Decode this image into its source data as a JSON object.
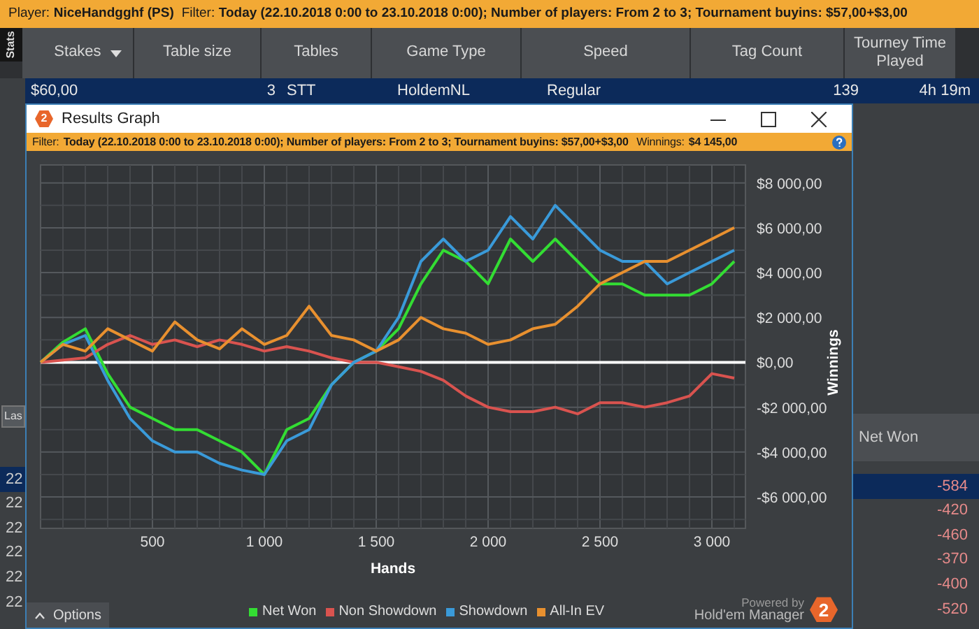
{
  "app": {
    "player_label": "Player:",
    "player": "NiceHandgghf (PS)",
    "filter_label": "Filter:",
    "filter": "Today (22.10.2018 0:00 to 23.10.2018 0:00); Number of players: From 2 to 3; Tournament buyins: $57,00+$3,00",
    "side_tab": "Stats",
    "columns": [
      "Stakes",
      "Table size",
      "Tables",
      "Game Type",
      "Speed",
      "Tag Count",
      "Tourney Time Played"
    ],
    "rows": [
      {
        "selected": true,
        "cells": [
          "$60,00",
          "3",
          "STT",
          "HoldemNL",
          "Regular",
          "139",
          "4h 19m"
        ]
      }
    ],
    "lower": {
      "button": "Las",
      "column_header": "Net Won",
      "rows": [
        {
          "date": "22",
          "net_won": "-584",
          "selected": true
        },
        {
          "date": "22",
          "net_won": "-420",
          "selected": false
        },
        {
          "date": "22",
          "net_won": "-460",
          "selected": false
        },
        {
          "date": "22",
          "net_won": "-370",
          "selected": false
        },
        {
          "date": "22",
          "net_won": "-400",
          "selected": false
        },
        {
          "date": "22",
          "net_won": "-520",
          "selected": false
        }
      ]
    }
  },
  "window": {
    "title_icon_text": "2",
    "title": "Results Graph",
    "filter_label": "Filter:",
    "filter": "Today (22.10.2018 0:00 to 23.10.2018 0:00); Number of players: From 2 to 3; Tournament buyins: $57,00+$3,00",
    "winnings_label": "Winnings:",
    "winnings": "$4 145,00",
    "chart_data": {
      "type": "line",
      "grid": true,
      "xlabel": "Hands",
      "ylabel": "Winnings",
      "x": [
        0,
        100,
        200,
        300,
        400,
        500,
        600,
        700,
        800,
        900,
        1000,
        1100,
        1200,
        1300,
        1400,
        1500,
        1600,
        1700,
        1800,
        1900,
        2000,
        2100,
        2200,
        2300,
        2400,
        2500,
        2600,
        2700,
        2800,
        2900,
        3000,
        3100
      ],
      "series": [
        {
          "name": "Net Won",
          "color": "#33dd33",
          "values": [
            0,
            900,
            1500,
            -500,
            -2000,
            -2500,
            -3000,
            -3000,
            -3500,
            -4000,
            -5000,
            -3000,
            -2500,
            -1000,
            0,
            500,
            1500,
            3500,
            5000,
            4500,
            3500,
            5500,
            4500,
            5500,
            4500,
            3500,
            3500,
            3000,
            3000,
            3000,
            3500,
            4500
          ]
        },
        {
          "name": "Non Showdown",
          "color": "#d9534f",
          "values": [
            0,
            100,
            200,
            800,
            1200,
            800,
            1000,
            700,
            1000,
            800,
            500,
            700,
            500,
            200,
            0,
            0,
            -200,
            -400,
            -800,
            -1500,
            -2000,
            -2200,
            -2200,
            -2000,
            -2300,
            -1800,
            -1800,
            -2000,
            -1800,
            -1500,
            -500,
            -700
          ]
        },
        {
          "name": "Showdown",
          "color": "#3a9ad9",
          "values": [
            0,
            800,
            1200,
            -800,
            -2500,
            -3500,
            -4000,
            -4000,
            -4500,
            -4800,
            -5000,
            -3500,
            -3000,
            -1000,
            0,
            500,
            2000,
            4500,
            5500,
            4500,
            5000,
            6500,
            5500,
            7000,
            6000,
            5000,
            4500,
            4500,
            3500,
            4000,
            4500,
            5000
          ]
        },
        {
          "name": "All-In EV",
          "color": "#e8902f",
          "values": [
            0,
            800,
            500,
            1500,
            1000,
            500,
            1800,
            1000,
            600,
            1500,
            800,
            1200,
            2500,
            1200,
            1000,
            500,
            1000,
            2000,
            1500,
            1300,
            800,
            1000,
            1500,
            1700,
            2500,
            3500,
            4000,
            4500,
            4500,
            5000,
            5500,
            6000
          ]
        }
      ],
      "xlim": [
        0,
        3150
      ],
      "ylim": [
        -7400,
        8800
      ],
      "xticks": [
        {
          "value": 500,
          "label": "500"
        },
        {
          "value": 1000,
          "label": "1 000"
        },
        {
          "value": 1500,
          "label": "1 500"
        },
        {
          "value": 2000,
          "label": "2 000"
        },
        {
          "value": 2500,
          "label": "2 500"
        },
        {
          "value": 3000,
          "label": "3 000"
        }
      ],
      "yticks": [
        {
          "value": 8000,
          "label": "$8 000,00"
        },
        {
          "value": 6000,
          "label": "$6 000,00"
        },
        {
          "value": 4000,
          "label": "$4 000,00"
        },
        {
          "value": 2000,
          "label": "$2 000,00"
        },
        {
          "value": 0,
          "label": "$0,00"
        },
        {
          "value": -2000,
          "label": "-$2 000,00"
        },
        {
          "value": -4000,
          "label": "-$4 000,00"
        },
        {
          "value": -6000,
          "label": "-$6 000,00"
        }
      ]
    },
    "options_button": "Options",
    "powered_by": "Powered by",
    "brand": "Hold'em Manager",
    "logo_text": "2"
  }
}
